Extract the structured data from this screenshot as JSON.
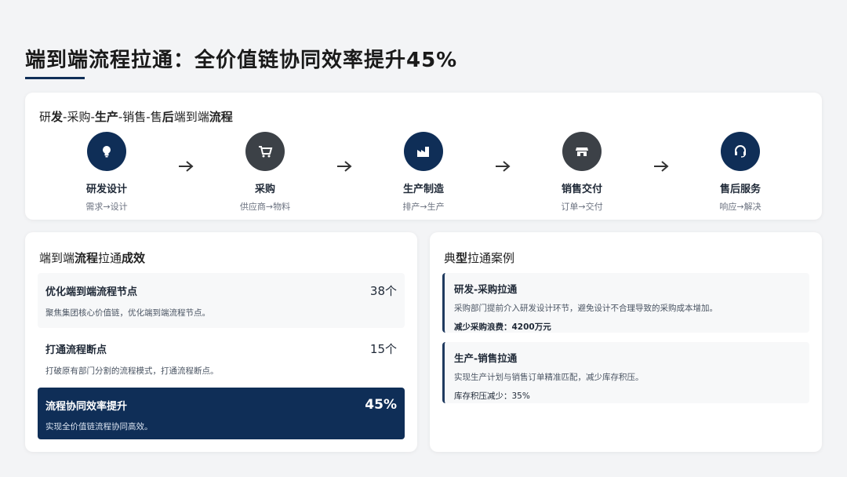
{
  "page": {
    "title": "端到端流程拉通：全价值链协同效率提升45%"
  },
  "flow": {
    "title_parts": [
      "研",
      "发",
      "-采购-",
      "生产",
      "-销售-售",
      "后",
      "端到端",
      "流程"
    ],
    "steps": [
      {
        "name": "研发设计",
        "sub": "需求→设计",
        "icon": "lightbulb-icon",
        "color": "#0f2e57"
      },
      {
        "name": "采购",
        "sub": "供应商→物料",
        "icon": "cart-icon",
        "color": "#3c4147"
      },
      {
        "name": "生产制造",
        "sub": "排产→生产",
        "icon": "factory-icon",
        "color": "#0f2e57"
      },
      {
        "name": "销售交付",
        "sub": "订单→交付",
        "icon": "store-icon",
        "color": "#3c4147"
      },
      {
        "name": "售后服务",
        "sub": "响应→解决",
        "icon": "headset-icon",
        "color": "#0f2e57"
      }
    ]
  },
  "results": {
    "title_parts": [
      "端到端",
      "流程",
      "拉通",
      "成效"
    ],
    "items": [
      {
        "label": "优化端到端流程节点",
        "value": "38个",
        "desc": "聚焦集团核心价值链，优化端到端流程节点。"
      },
      {
        "label": "打通流程断点",
        "value": "15个",
        "desc": "打破原有部门分割的流程模式，打通流程断点。"
      },
      {
        "label": "流程协同效率提升",
        "value": "45%",
        "desc": "实现全价值链流程协同高效。"
      }
    ]
  },
  "cases": {
    "title_parts": [
      "典",
      "型",
      "拉通案例"
    ],
    "items": [
      {
        "title": "研发-采购拉通",
        "desc": "采购部门提前介入研发设计环节，避免设计不合理导致的采购成本增加。",
        "metric_label": "减少采购浪费：",
        "metric_value": "4200万元"
      },
      {
        "title": "生产-销售拉通",
        "desc": "实现生产计划与销售订单精准匹配，减少库存积压。",
        "metric_label": "库存积压减少：",
        "metric_value": "35%"
      }
    ]
  },
  "colors": {
    "navy": "#0f2e57",
    "gray": "#3c4147"
  }
}
